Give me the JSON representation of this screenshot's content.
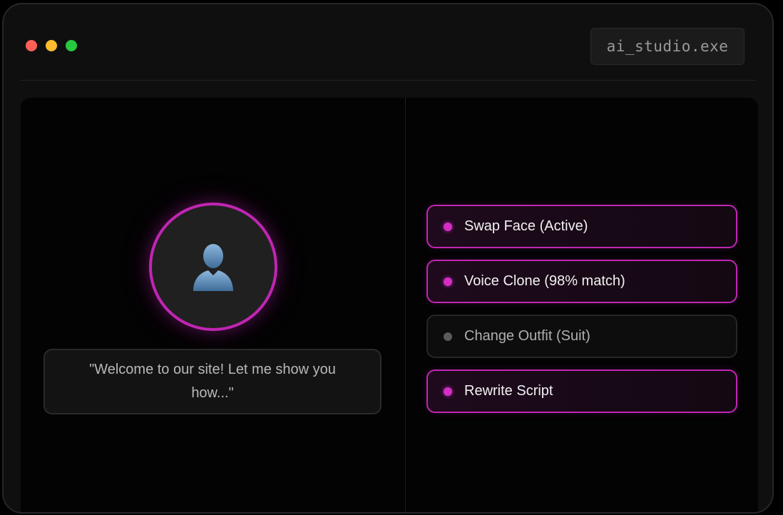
{
  "window": {
    "filename": "ai_studio.exe",
    "controls": [
      {
        "name": "close",
        "color": "#ff5f57"
      },
      {
        "name": "minimize",
        "color": "#febc2e"
      },
      {
        "name": "maximize",
        "color": "#28c840"
      }
    ]
  },
  "preview": {
    "avatar_icon": "person-silhouette-icon",
    "caption": "\"Welcome to our site! Let me show you how...\""
  },
  "options": [
    {
      "label": "Swap Face (Active)",
      "active": true
    },
    {
      "label": "Voice Clone (98% match)",
      "active": true
    },
    {
      "label": "Change Outfit (Suit)",
      "active": false
    },
    {
      "label": "Rewrite Script",
      "active": true
    }
  ],
  "colors": {
    "accent": "#c026b3",
    "background": "#0f0f0f",
    "panel": "#030303"
  }
}
